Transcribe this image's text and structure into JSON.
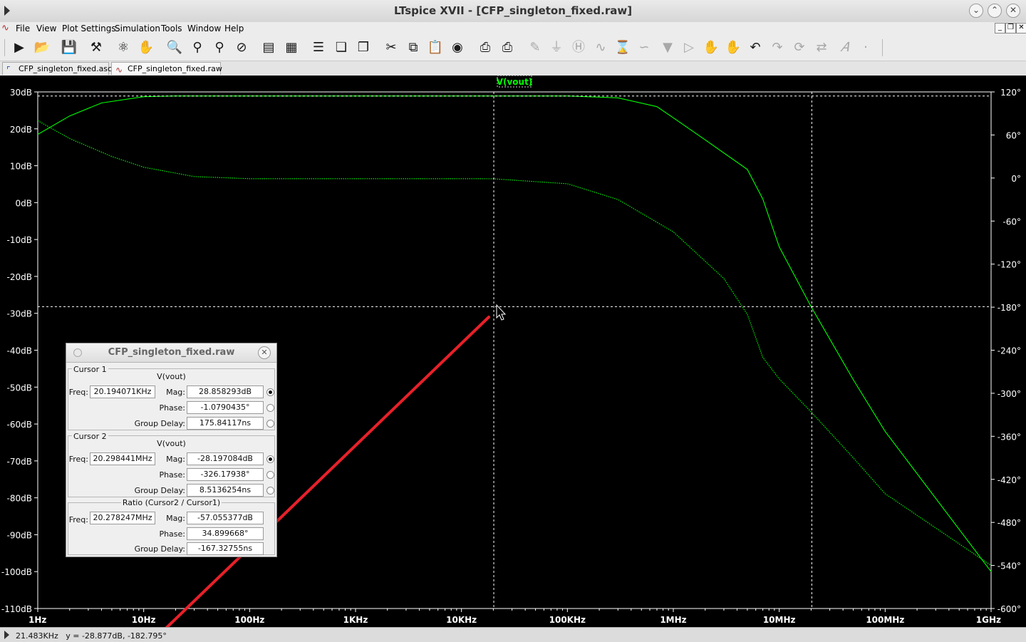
{
  "window": {
    "title": "LTspice XVII - [CFP_singleton_fixed.raw]"
  },
  "menu": [
    "File",
    "View",
    "Plot Settings",
    "Simulation",
    "Tools",
    "Window",
    "Help"
  ],
  "tabs": [
    {
      "label": "CFP_singleton_fixed.asc",
      "active": false
    },
    {
      "label": "CFP_singleton_fixed.raw",
      "active": true
    }
  ],
  "plot": {
    "trace_label": "V(vout)",
    "trace_color": "#00ff00",
    "cursor_color": "#ffffff",
    "annotation_color": "#e8202a"
  },
  "chart_data": {
    "type": "line",
    "x_scale": "log",
    "xlim_hz": [
      1,
      1000000000
    ],
    "x_ticks": [
      "1Hz",
      "10Hz",
      "100Hz",
      "1KHz",
      "10KHz",
      "100KHz",
      "1MHz",
      "10MHz",
      "100MHz",
      "1GHz"
    ],
    "ylim_db": [
      -110,
      30
    ],
    "y_ticks": [
      "30dB",
      "20dB",
      "10dB",
      "0dB",
      "-10dB",
      "-20dB",
      "-30dB",
      "-40dB",
      "-50dB",
      "-60dB",
      "-70dB",
      "-80dB",
      "-90dB",
      "-100dB",
      "-110dB"
    ],
    "y2lim_deg": [
      -600,
      120
    ],
    "y2_ticks": [
      "120°",
      "60°",
      "0°",
      "-60°",
      "-120°",
      "-180°",
      "-240°",
      "-300°",
      "-360°",
      "-420°",
      "-480°",
      "-540°",
      "-600°"
    ],
    "legend_placement": "top-center",
    "series": [
      {
        "name": "V(vout)",
        "axis": "magnitude_db",
        "x": [
          1,
          2,
          4,
          10,
          20,
          100,
          1000,
          10000,
          100000,
          300000,
          700000,
          1000000,
          2000000,
          5000000,
          7000000,
          10000000,
          20000000,
          50000000,
          100000000,
          1000000000
        ],
        "y": [
          18.5,
          23.5,
          27,
          28.7,
          28.9,
          28.9,
          28.9,
          28.9,
          28.9,
          28.4,
          26,
          23,
          17,
          9,
          1,
          -12,
          -28.2,
          -48,
          -62,
          -100
        ]
      },
      {
        "name": "V(vout)",
        "axis": "phase_deg",
        "line": "dotted",
        "x": [
          1,
          2,
          5,
          10,
          30,
          100,
          1000,
          10000,
          20000,
          100000,
          300000,
          1000000,
          3000000,
          5000000,
          7000000,
          10000000,
          20000000,
          50000000,
          100000000,
          1000000000
        ],
        "y": [
          80,
          55,
          30,
          15,
          2,
          -1,
          -1,
          -1,
          -1.1,
          -8,
          -30,
          -75,
          -140,
          -190,
          -250,
          -280,
          -326,
          -390,
          -440,
          -540
        ]
      }
    ]
  },
  "cursors": {
    "cursor1": {
      "freq_hz": 20194.071
    },
    "cursor2": {
      "freq_hz": 20298441,
      "level_db": -28.197
    }
  },
  "dialog": {
    "title": "CFP_singleton_fixed.raw",
    "cursor1": {
      "label": "Cursor 1",
      "trace": "V(vout)",
      "freq_label": "Freq:",
      "freq": "20.194071KHz",
      "mag_label": "Mag:",
      "mag": "28.858293dB",
      "phase_label": "Phase:",
      "phase": "-1.0790435°",
      "gd_label": "Group Delay:",
      "gd": "175.84117ns"
    },
    "cursor2": {
      "label": "Cursor 2",
      "trace": "V(vout)",
      "freq_label": "Freq:",
      "freq": "20.298441MHz",
      "mag_label": "Mag:",
      "mag": "-28.197084dB",
      "phase_label": "Phase:",
      "phase": "-326.17938°",
      "gd_label": "Group Delay:",
      "gd": "8.5136254ns"
    },
    "ratio": {
      "label": "Ratio (Cursor2 / Cursor1)",
      "freq_label": "Freq:",
      "freq": "20.278247MHz",
      "mag_label": "Mag:",
      "mag": "-57.055377dB",
      "phase_label": "Phase:",
      "phase": "34.899668°",
      "gd_label": "Group Delay:",
      "gd": "-167.32755ns"
    }
  },
  "status": {
    "text": "21.483KHz   y = -28.877dB, -182.795°"
  }
}
